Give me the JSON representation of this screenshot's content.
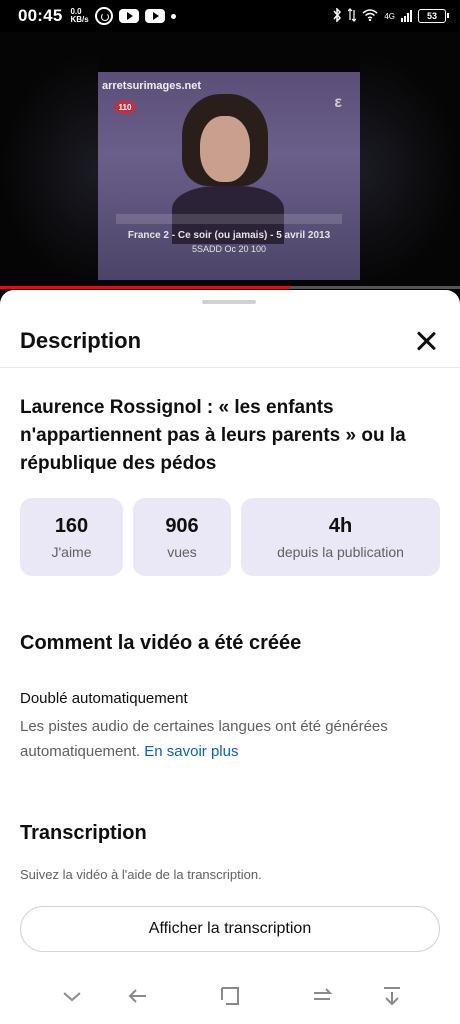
{
  "status": {
    "time": "00:45",
    "net_speed_top": "0.0",
    "net_speed_bottom": "KB/s",
    "battery": "53",
    "signal_label": "4G"
  },
  "video": {
    "watermark": "arretsurimages.net",
    "channel_logo": "110",
    "overlay_line1": "France 2 - Ce soir (ou jamais) - 5 avril 2013",
    "overlay_line2": "5SADD    Oc    20 100",
    "progress_fraction": 0.63
  },
  "sheet": {
    "title": "Description",
    "video_title": "Laurence Rossignol : « les enfants n'appartiennent pas à leurs parents » ou la république des pédos",
    "stats": [
      {
        "value": "160",
        "label": "J'aime"
      },
      {
        "value": "906",
        "label": "vues"
      },
      {
        "value": "4h",
        "label": "depuis la publication"
      }
    ],
    "how_made": {
      "heading": "Comment la vidéo a été créée",
      "dub_title": "Doublé automatiquement",
      "dub_text": "Les pistes audio de certaines langues ont été générées automatiquement.",
      "learn_more": "En savoir plus"
    },
    "transcription": {
      "heading": "Transcription",
      "subtitle": "Suivez la vidéo à l'aide de la transcription.",
      "button": "Afficher la transcription"
    }
  },
  "colors": {
    "accent_link": "#065fd4",
    "stat_bg": "#eae7f6",
    "progress": "#ff0000"
  }
}
